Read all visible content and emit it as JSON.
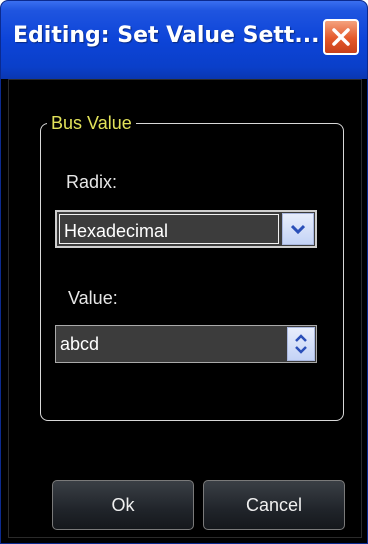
{
  "window": {
    "title": "Editing: Set Value Sett...",
    "close_icon": "close-icon"
  },
  "group": {
    "legend": "Bus Value",
    "radix_label": "Radix:",
    "radix_value": "Hexadecimal",
    "value_label": "Value:",
    "value_value": "abcd"
  },
  "buttons": {
    "ok": "Ok",
    "cancel": "Cancel"
  },
  "colors": {
    "titlebar": "#0d44d8",
    "legend": "#e2e25a",
    "close": "#e4582a"
  }
}
